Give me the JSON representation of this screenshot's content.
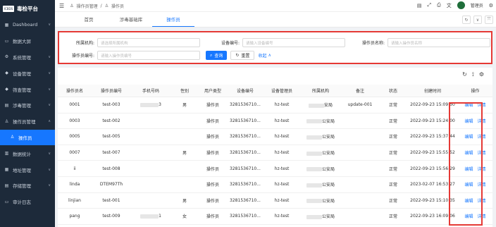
{
  "brand": {
    "badge": "ICBDS",
    "name": "毒检平台"
  },
  "sidebar": {
    "items": [
      {
        "label": "Dashboard",
        "icon": "grid-icon",
        "glyph": "▦",
        "arrow": "∨"
      },
      {
        "label": "数据大屏",
        "icon": "monitor-icon",
        "glyph": "▭",
        "arrow": ""
      },
      {
        "label": "系统管理",
        "icon": "gear-icon",
        "glyph": "⚙",
        "arrow": "∨"
      },
      {
        "label": "设备管理",
        "icon": "device-icon",
        "glyph": "◆",
        "arrow": "∨"
      },
      {
        "label": "筛查管理",
        "icon": "filter-icon",
        "glyph": "◆",
        "arrow": "∨"
      },
      {
        "label": "涉毒管理",
        "icon": "list-icon",
        "glyph": "▤",
        "arrow": "∨"
      },
      {
        "label": "操作员管理",
        "icon": "user-icon",
        "glyph": "♙",
        "arrow": "∧"
      },
      {
        "label": "操作员",
        "icon": "user-icon",
        "glyph": "♙",
        "arrow": "",
        "sub": true,
        "active": true
      },
      {
        "label": "数据统计",
        "icon": "chart-icon",
        "glyph": "▥",
        "arrow": "∨"
      },
      {
        "label": "地址管理",
        "icon": "map-icon",
        "glyph": "▦",
        "arrow": "∨"
      },
      {
        "label": "存储管理",
        "icon": "storage-icon",
        "glyph": "▤",
        "arrow": "∨"
      },
      {
        "label": "审计日志",
        "icon": "log-icon",
        "glyph": "▭",
        "arrow": ""
      }
    ]
  },
  "topbar": {
    "menu_icon": "☰",
    "breadcrumb_1": "操作员管理",
    "separator": "/",
    "breadcrumb_2": "操作员",
    "user": "管理员"
  },
  "tabs": [
    {
      "label": "首页"
    },
    {
      "label": "涉毒基础库"
    },
    {
      "label": "操作员"
    }
  ],
  "search": {
    "org_label": "所属机构:",
    "org_placeholder": "请选择所属机构",
    "device_label": "设备编号:",
    "device_placeholder": "请输入设备编号",
    "opname_label": "操作员名称:",
    "opname_placeholder": "请输入操作员名称",
    "opno_label": "操作员编号:",
    "opno_placeholder": "请输入操作员编号",
    "query": "查询",
    "reset": "重置",
    "collapse": "收起"
  },
  "table": {
    "columns": [
      "操作员名",
      "操作员编号",
      "手机号码",
      "性别",
      "用户类型",
      "设备编号",
      "设备管理员",
      "所属机构",
      "备注",
      "状态",
      "创建时间",
      "操作"
    ],
    "edit": "编辑",
    "detail": "详情",
    "rows": [
      {
        "name": "0001",
        "no": "test-003",
        "phone": "3",
        "gender": "男",
        "type": "操作员",
        "device": "3281536710...",
        "admin": "hz-test",
        "org": "安局",
        "remark": "update-001",
        "status": "正常",
        "created": "2022-09-23 15:09:50"
      },
      {
        "name": "0003",
        "no": "test-002",
        "phone": "",
        "gender": "",
        "type": "操作员",
        "device": "3281536710...",
        "admin": "hz-test",
        "org": "公安局",
        "remark": "",
        "status": "正常",
        "created": "2022-09-23 15:24:00"
      },
      {
        "name": "0005",
        "no": "test-005",
        "phone": "",
        "gender": "",
        "type": "操作员",
        "device": "3281536710...",
        "admin": "hz-test",
        "org": "公安局",
        "remark": "",
        "status": "正常",
        "created": "2022-09-23 15:37:44"
      },
      {
        "name": "0007",
        "no": "test-007",
        "phone": "",
        "gender": "男",
        "type": "操作员",
        "device": "3281536710...",
        "admin": "hz-test",
        "org": "公安局",
        "remark": "",
        "status": "正常",
        "created": "2022-09-23 15:55:52"
      },
      {
        "name": "ii",
        "no": "test-008",
        "phone": "",
        "gender": "",
        "type": "操作员",
        "device": "3281536710...",
        "admin": "hz-test",
        "org": "公安局",
        "remark": "",
        "status": "正常",
        "created": "2022-09-23 15:56:29"
      },
      {
        "name": "linda",
        "no": "DTEM97Th",
        "phone": "",
        "gender": "",
        "type": "操作员",
        "device": "3281536710...",
        "admin": "hz-test",
        "org": "公安局",
        "remark": "",
        "status": "正常",
        "created": "2023-02-07 16:53:27"
      },
      {
        "name": "linjian",
        "no": "test-001",
        "phone": "",
        "gender": "男",
        "type": "操作员",
        "device": "3281536710...",
        "admin": "hz-test",
        "org": "公安局",
        "remark": "",
        "status": "正常",
        "created": "2022-09-23 15:10:35"
      },
      {
        "name": "pang",
        "no": "test-009",
        "phone": "1",
        "gender": "女",
        "type": "操作员",
        "device": "3281536710...",
        "admin": "hz-test",
        "org": "公安局",
        "remark": "",
        "status": "正常",
        "created": "2022-09-23 16:09:06"
      }
    ]
  }
}
